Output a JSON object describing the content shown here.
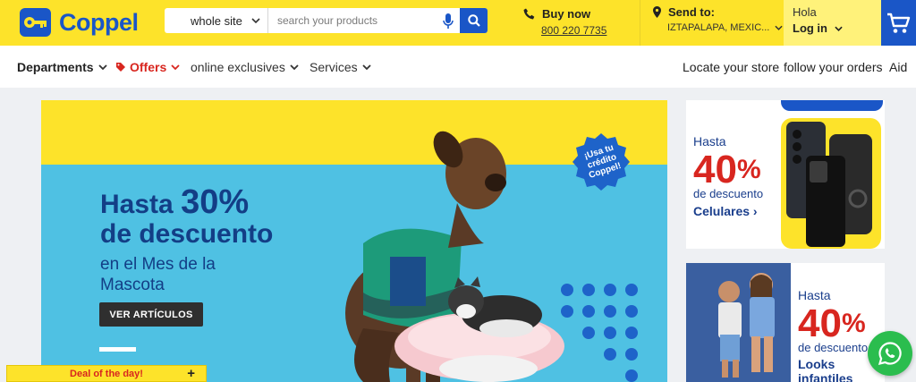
{
  "header": {
    "brand": "Coppel",
    "search": {
      "scope": "whole site",
      "placeholder": "search your products"
    },
    "buy_now": {
      "label": "Buy now",
      "phone": "800 220 7735"
    },
    "send_to": {
      "label": "Send to:",
      "location": "IZTAPALAPA, MEXIC..."
    },
    "account": {
      "greeting": "Hola",
      "login": "Log in"
    }
  },
  "nav": {
    "left": [
      "Departments",
      "Offers",
      "online exclusives",
      "Services"
    ],
    "right": [
      "Locate your store",
      "follow your orders",
      "Aid"
    ]
  },
  "hero": {
    "line1": "Hasta",
    "percent": "30%",
    "line2": "de descuento",
    "sub": "en el Mes de la Mascota",
    "button": "VER ARTÍCULOS",
    "badge": "¡Usa tu crédito Coppel!"
  },
  "promos": [
    {
      "hasta": "Hasta",
      "percent": "40",
      "percent_sign": "%",
      "desc": "de descuento",
      "category": "Celulares ›"
    },
    {
      "hasta": "Hasta",
      "percent": "40",
      "percent_sign": "%",
      "desc": "de descuento",
      "category": "Looks infantiles"
    }
  ],
  "floating": {
    "deal": "Deal of the day!",
    "deal_action": "+"
  },
  "colors": {
    "brand_yellow": "#fde32a",
    "brand_blue": "#1a56c7",
    "offer_red": "#d8261f",
    "hero_blue": "#4fc1e3",
    "whatsapp_green": "#2bbd4e"
  }
}
